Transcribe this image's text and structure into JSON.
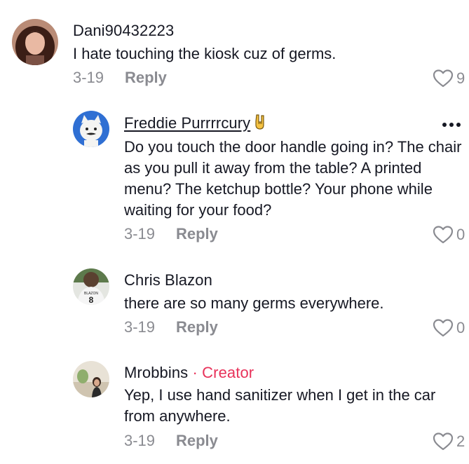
{
  "comments": [
    {
      "username": "Dani90432223",
      "text": "I hate touching the kiosk cuz of germs.",
      "date": "3-19",
      "reply_label": "Reply",
      "likes": "9"
    },
    {
      "username": "Freddie Purrrrcury",
      "text": "Do you touch the door handle going in? The chair as you pull it away from the table? A printed menu? The ketchup bottle? Your phone while waiting for your food?",
      "date": "3-19",
      "reply_label": "Reply",
      "likes": "0",
      "emoji_icon": "rock-on-hand-icon"
    },
    {
      "username": "Chris Blazon",
      "text": "there are so many germs everywhere.",
      "date": "3-19",
      "reply_label": "Reply",
      "likes": "0"
    },
    {
      "username": "Mrobbins",
      "creator_tag": "· Creator",
      "text": "Yep, I use hand sanitizer when I get in the car from anywhere.",
      "date": "3-19",
      "reply_label": "Reply",
      "likes": "2"
    }
  ],
  "colors": {
    "text": "#161823",
    "muted": "#8a8b91",
    "creator": "#e8325a"
  },
  "icons": {
    "like": "heart-outline-icon",
    "more": "more-dots-icon"
  }
}
